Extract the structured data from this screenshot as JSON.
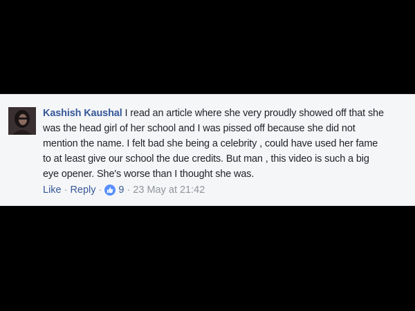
{
  "comment": {
    "author": "Kashish Kaushal",
    "text_lines": [
      " I read an article where she very proudly showed off that she",
      "was the head girl of her school and I was pissed off because she did not",
      "mention the name. I felt bad she being a celebrity , could have used her fame",
      "to at least give our school the due credits. But man , this video is such a big",
      "eye opener. She's worse than I thought she was."
    ],
    "actions": {
      "like_label": "Like",
      "separator": "·",
      "reply_label": "Reply",
      "reaction_count": "9",
      "timestamp": "23 May at 21:42"
    }
  },
  "icons": {
    "avatar": "profile-photo",
    "reaction": "thumbs-up-icon"
  },
  "colors": {
    "page_background": "#000000",
    "card_background": "#f5f6f7",
    "author_link": "#365899",
    "body_text": "#1d2129",
    "meta_text": "#90949c",
    "like_badge": "#5890ff"
  }
}
